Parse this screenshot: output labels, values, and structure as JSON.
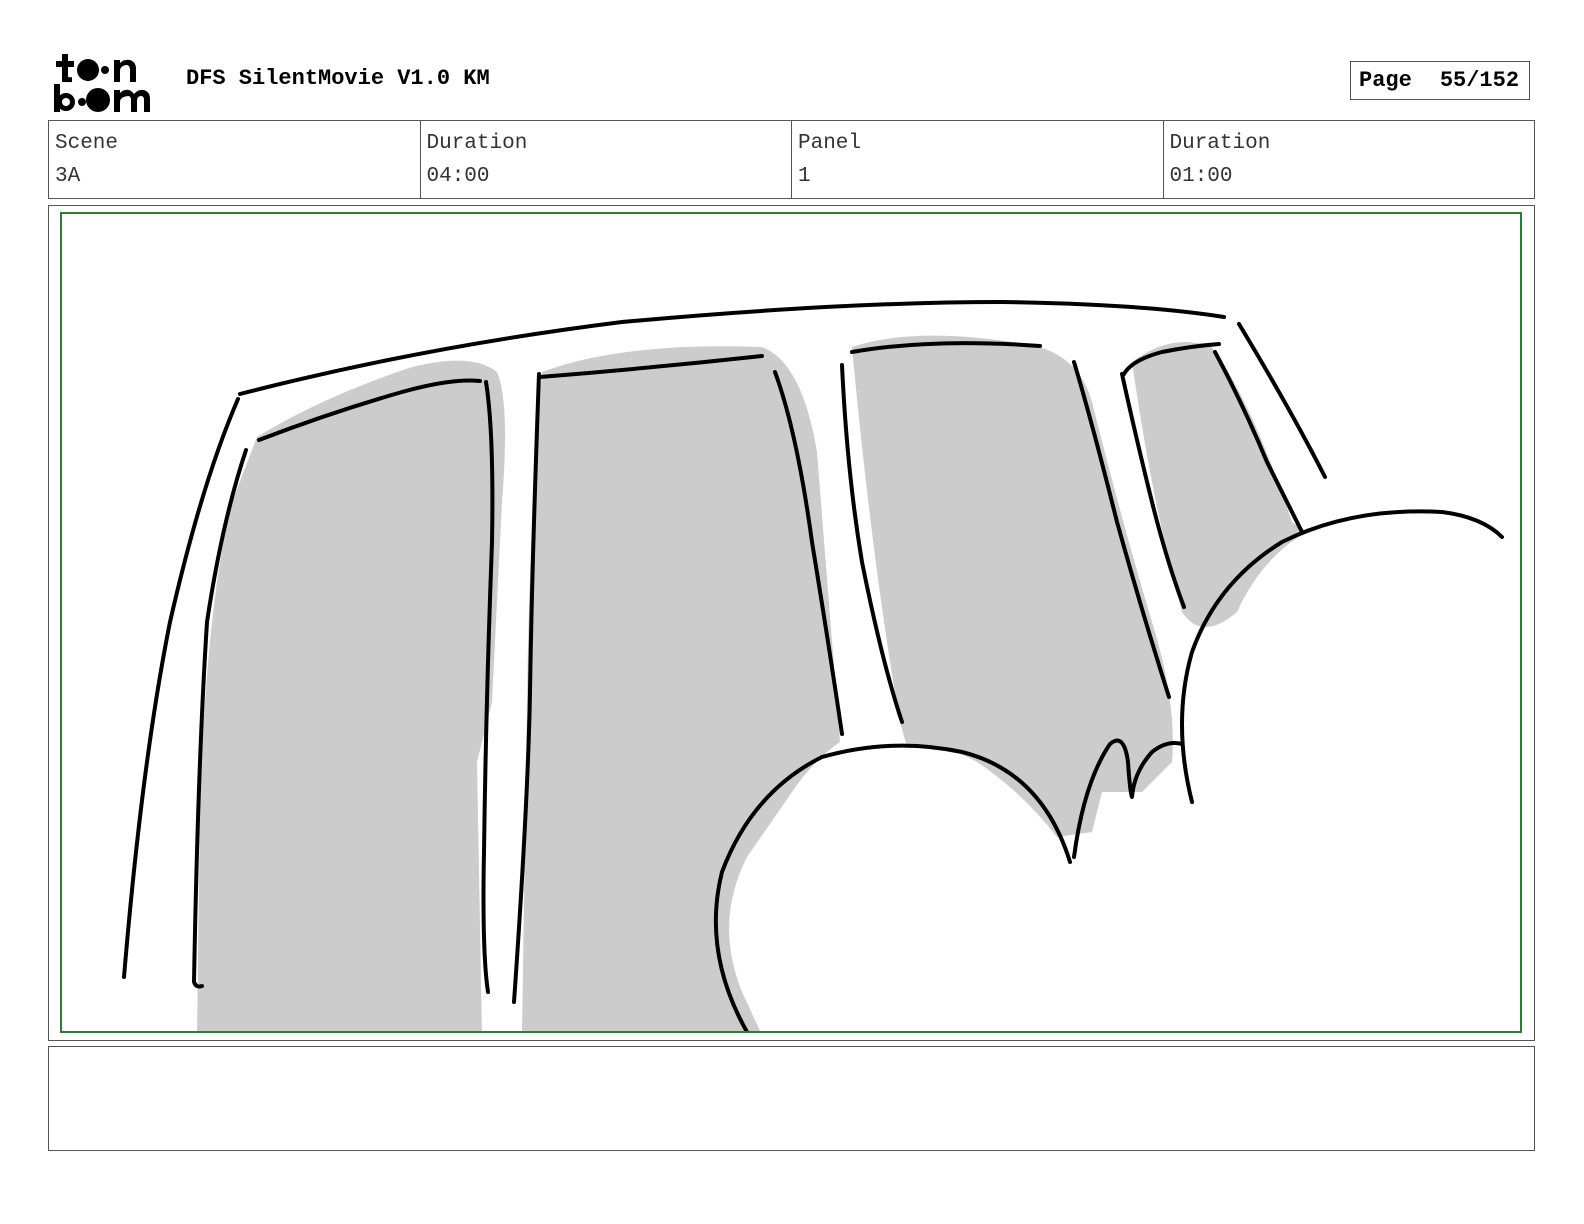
{
  "header": {
    "logo_text": "toon boom",
    "title": "DFS SilentMovie V1.0 KM",
    "page_label": "Page",
    "page_number": "55/152"
  },
  "info": {
    "scene_label": "Scene",
    "scene_value": "3A",
    "scene_duration_label": "Duration",
    "scene_duration_value": "04:00",
    "panel_label": "Panel",
    "panel_value": "1",
    "panel_duration_label": "Duration",
    "panel_duration_value": "01:00"
  },
  "panel": {
    "frame_color": "#2e7d32",
    "shade_color": "#cccccc"
  },
  "notes": {
    "text": ""
  }
}
